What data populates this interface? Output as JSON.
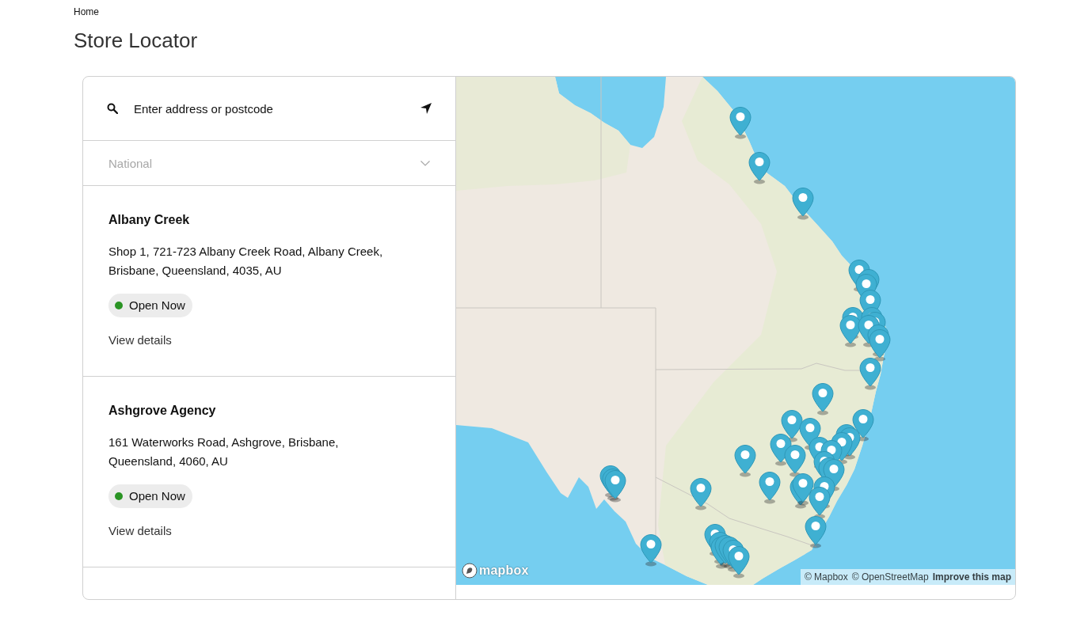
{
  "breadcrumb": "Home",
  "title": "Store Locator",
  "search": {
    "placeholder": "Enter address or postcode"
  },
  "region_select": {
    "value": "National"
  },
  "stores": [
    {
      "name": "Albany Creek",
      "address_lines": [
        "Shop 1, 721-723 Albany Creek Road, Albany Creek,",
        "Brisbane, Queensland, 4035, AU"
      ],
      "status": {
        "label": "Open Now",
        "open": true
      },
      "link": "View details"
    },
    {
      "name": "Ashgrove Agency",
      "address_lines": [
        "161 Waterworks Road, Ashgrove, Brisbane,",
        "Queensland, 4060, AU"
      ],
      "status": {
        "label": "Open Now",
        "open": true
      },
      "link": "View details"
    }
  ],
  "map": {
    "logo": "mapbox",
    "attribution": [
      {
        "text": "© Mapbox",
        "strong": false
      },
      {
        "text": "© OpenStreetMap",
        "strong": false
      },
      {
        "text": "Improve this map",
        "strong": true
      }
    ]
  }
}
